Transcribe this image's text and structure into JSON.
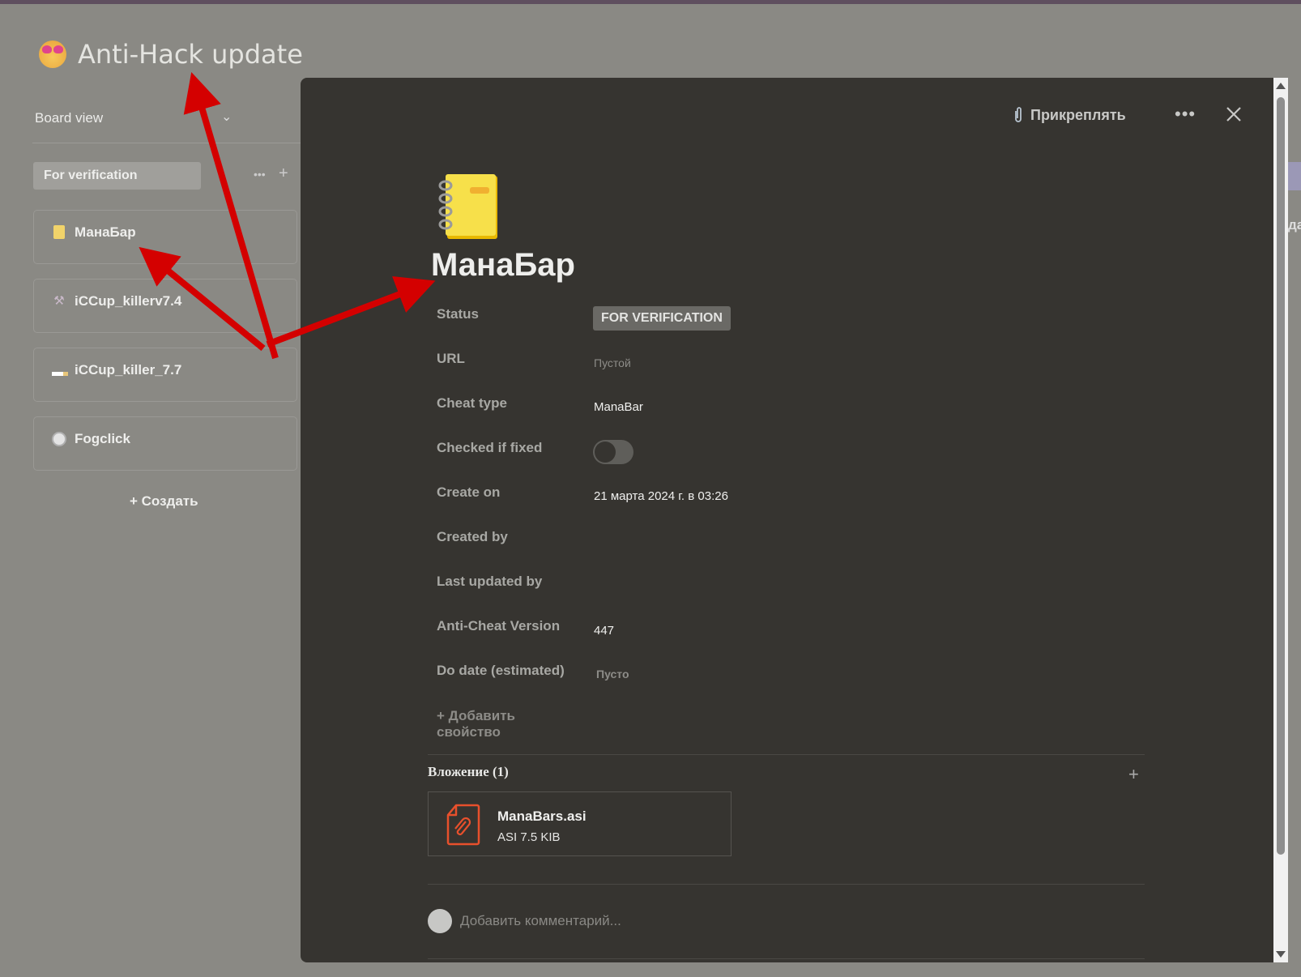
{
  "board": {
    "title": "Anti-Hack update",
    "title_icon": "heart-eyes-emoji",
    "view_label": "Board view",
    "column": {
      "label": "For verification"
    },
    "cards": [
      {
        "label": "МанаБар",
        "icon": "notebook-icon"
      },
      {
        "label": "iCCup_killerv7.4",
        "icon": "hammer-pick-icon"
      },
      {
        "label": "iCCup_killer_7.7",
        "icon": "cigarette-icon"
      },
      {
        "label": "Fogclick",
        "icon": "clock-icon"
      }
    ],
    "create_label": "+ Создать",
    "right_clipped_text": "дат"
  },
  "modal": {
    "attach_label": "Прикреплять",
    "page_title": "МанаБар",
    "properties": [
      {
        "label": "Status",
        "value": "FOR VERIFICATION"
      },
      {
        "label": "URL",
        "value": "Пустой"
      },
      {
        "label": "Cheat type",
        "value": "ManaBar"
      },
      {
        "label": "Checked if fixed",
        "value": false
      },
      {
        "label": "Create on",
        "value": "21 марта 2024 г. в 03:26"
      },
      {
        "label": "Created by",
        "value": ""
      },
      {
        "label": "Last updated by",
        "value": ""
      },
      {
        "label": "Anti-Cheat Version",
        "value": "447"
      },
      {
        "label": "Do date (estimated)",
        "value": "Пусто"
      }
    ],
    "add_property_line1": "+ Добавить",
    "add_property_line2": "свойство",
    "attachments_header": "Вложение (1)",
    "attachment": {
      "name": "ManaBars.asi",
      "meta": "ASI 7.5 KIB"
    },
    "comment_placeholder": "Добавить комментарий..."
  },
  "colors": {
    "arrow": "#d40000",
    "file_icon": "#e8502c",
    "modal_bg": "#363430",
    "page_bg": "#8a8984"
  }
}
